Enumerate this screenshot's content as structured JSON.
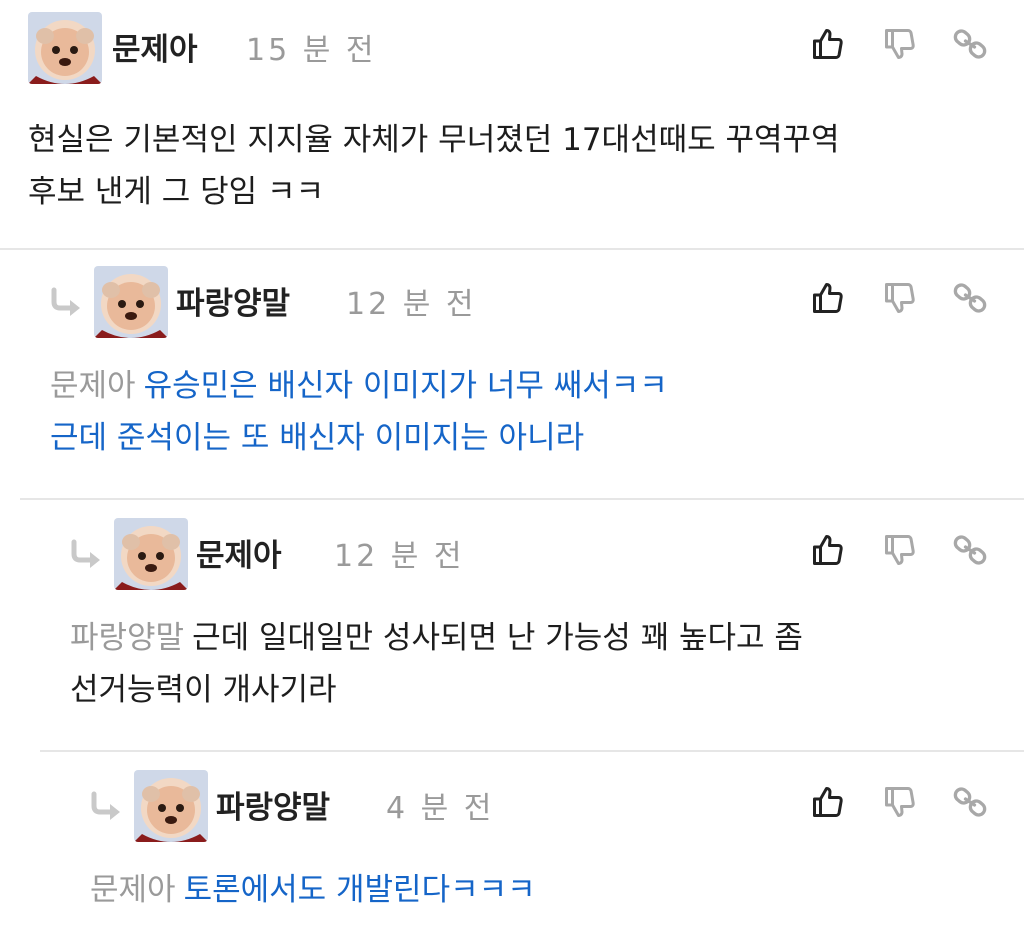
{
  "comments": [
    {
      "author": "문제아",
      "time": "15 분 전",
      "mention": "",
      "lines": [
        "현실은 기본적인 지지율 자체가 무너졌던 17대선때도 꾸역꾸역",
        "후보 낸게 그 당임 ㅋㅋ"
      ],
      "text_color": "default"
    },
    {
      "author": "파랑양말",
      "time": "12 분 전",
      "mention": "문제아",
      "lines": [
        "유승민은 배신자 이미지가 너무 쌔서ㅋㅋ",
        "근데 준석이는 또 배신자 이미지는 아니라"
      ],
      "text_color": "#1565c8"
    },
    {
      "author": "문제아",
      "time": "12 분 전",
      "mention": "파랑양말",
      "lines": [
        "근데 일대일만 성사되면 난 가능성 꽤 높다고 좀",
        "선거능력이 개사기라"
      ],
      "text_color": "default"
    },
    {
      "author": "파랑양말",
      "time": "4 분 전",
      "mention": "문제아",
      "lines": [
        "토론에서도 개발린다ㅋㅋㅋ"
      ],
      "text_color": "#1565c8"
    }
  ],
  "icons": {
    "like": "thumbs-up-icon",
    "dislike": "thumbs-down-icon",
    "link": "link-icon",
    "reply": "reply-arrow-icon"
  },
  "colors": {
    "accent_blue": "#1565c8",
    "meta_gray": "#9a9a9a",
    "divider": "#e6e6e6"
  }
}
